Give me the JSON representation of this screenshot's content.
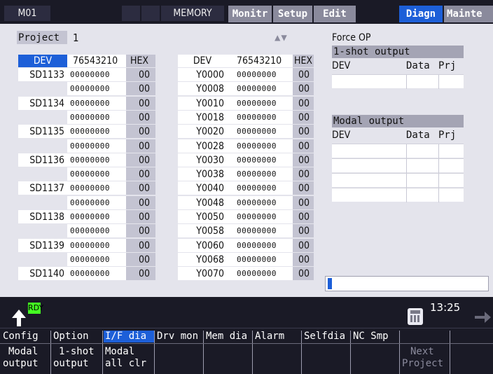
{
  "topbar": {
    "system": "M01",
    "mode": "MEMORY",
    "tabs": [
      {
        "label": "Monitr",
        "active": false
      },
      {
        "label": "Setup",
        "active": false
      },
      {
        "label": "Edit",
        "active": false
      },
      {
        "label": "Diagn",
        "active": true
      },
      {
        "label": "Mainte",
        "active": false
      }
    ]
  },
  "project": {
    "label": "Project",
    "value": "1"
  },
  "arrows": "▲▼",
  "left_table": {
    "headers": {
      "dev": "DEV",
      "bits": "76543210",
      "hex": "HEX"
    },
    "rows": [
      {
        "dev": "SD1133",
        "bits": "00000000",
        "hex": "00"
      },
      {
        "dev": "",
        "bits": "00000000",
        "hex": "00"
      },
      {
        "dev": "SD1134",
        "bits": "00000000",
        "hex": "00"
      },
      {
        "dev": "",
        "bits": "00000000",
        "hex": "00"
      },
      {
        "dev": "SD1135",
        "bits": "00000000",
        "hex": "00"
      },
      {
        "dev": "",
        "bits": "00000000",
        "hex": "00"
      },
      {
        "dev": "SD1136",
        "bits": "00000000",
        "hex": "00"
      },
      {
        "dev": "",
        "bits": "00000000",
        "hex": "00"
      },
      {
        "dev": "SD1137",
        "bits": "00000000",
        "hex": "00"
      },
      {
        "dev": "",
        "bits": "00000000",
        "hex": "00"
      },
      {
        "dev": "SD1138",
        "bits": "00000000",
        "hex": "00"
      },
      {
        "dev": "",
        "bits": "00000000",
        "hex": "00"
      },
      {
        "dev": "SD1139",
        "bits": "00000000",
        "hex": "00"
      },
      {
        "dev": "",
        "bits": "00000000",
        "hex": "00"
      },
      {
        "dev": "SD1140",
        "bits": "00000000",
        "hex": "00"
      }
    ]
  },
  "right_table": {
    "headers": {
      "dev": "DEV",
      "bits": "76543210",
      "hex": "HEX"
    },
    "rows": [
      {
        "dev": "Y0000",
        "bits": "00000000",
        "hex": "00"
      },
      {
        "dev": "Y0008",
        "bits": "00000000",
        "hex": "00"
      },
      {
        "dev": "Y0010",
        "bits": "00000000",
        "hex": "00"
      },
      {
        "dev": "Y0018",
        "bits": "00000000",
        "hex": "00"
      },
      {
        "dev": "Y0020",
        "bits": "00000000",
        "hex": "00"
      },
      {
        "dev": "Y0028",
        "bits": "00000000",
        "hex": "00"
      },
      {
        "dev": "Y0030",
        "bits": "00000000",
        "hex": "00"
      },
      {
        "dev": "Y0038",
        "bits": "00000000",
        "hex": "00"
      },
      {
        "dev": "Y0040",
        "bits": "00000000",
        "hex": "00"
      },
      {
        "dev": "Y0048",
        "bits": "00000000",
        "hex": "00"
      },
      {
        "dev": "Y0050",
        "bits": "00000000",
        "hex": "00"
      },
      {
        "dev": "Y0058",
        "bits": "00000000",
        "hex": "00"
      },
      {
        "dev": "Y0060",
        "bits": "00000000",
        "hex": "00"
      },
      {
        "dev": "Y0068",
        "bits": "00000000",
        "hex": "00"
      },
      {
        "dev": "Y0070",
        "bits": "00000000",
        "hex": "00"
      }
    ]
  },
  "force_op": {
    "title": "Force OP",
    "one_shot": {
      "title": "1-shot output",
      "col_dev": "DEV",
      "col_data": "Data",
      "col_prj": "Prj"
    },
    "modal": {
      "title": "Modal output",
      "col_dev": "DEV",
      "col_data": "Data",
      "col_prj": "Prj"
    }
  },
  "status": {
    "rdy": "RDY",
    "time": "13:25"
  },
  "softkeys": {
    "menu": [
      "Config",
      "Option",
      "I/F dia",
      "Drv mon",
      "Mem dia",
      "Alarm",
      "Selfdia",
      "NC Smp"
    ],
    "sub": [
      {
        "l1": "Modal",
        "l2": "output"
      },
      {
        "l1": "1-shot",
        "l2": "output"
      },
      {
        "l1": "Modal",
        "l2": "all clr"
      },
      {
        "l1": "Next",
        "l2": "Project"
      }
    ]
  },
  "colors": {
    "accent": "#1d5fd8",
    "rdy": "#44ff22",
    "panel": "#e4e4ec",
    "bar": "#1a1a26"
  }
}
